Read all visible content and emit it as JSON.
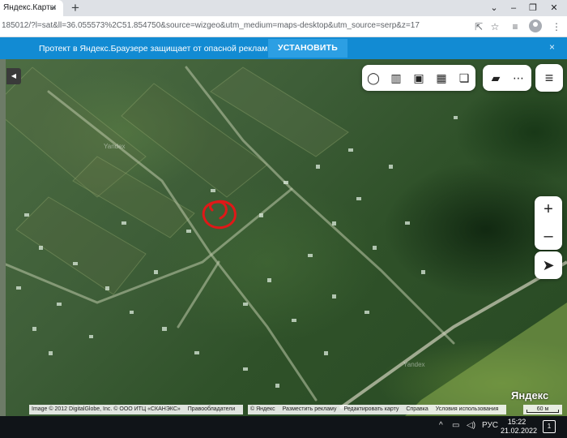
{
  "browser": {
    "tab_title": "Яндекс.Карты",
    "tab_close": "×",
    "new_tab": "+",
    "url": "185012/?l=sat&ll=36.055573%2C51.854750&source=wizgeo&utm_medium=maps-desktop&utm_source=serp&z=17",
    "window_buttons": [
      "⌄",
      "–",
      "❐",
      "✕"
    ]
  },
  "promo": {
    "text": "Протект в Яндекс.Браузере защищает от опасной рекламы",
    "button": "УСТАНОВИТЬ",
    "close": "×"
  },
  "map": {
    "watermarks": [
      "Yandex",
      "Yandex"
    ],
    "icons": [
      "layers-icon",
      "panorama-icon",
      "photo-icon",
      "transport-icon",
      "traffic-icon",
      "ruler-icon",
      "more-icon",
      "menu-icon"
    ],
    "zoom_in": "+",
    "zoom_out": "–"
  },
  "footer": {
    "left_items": [
      "Image © 2012 DigitalGlobe, Inc. © ООО ИТЦ «СКАНЭКС»",
      "Правообладатели"
    ],
    "right_items": [
      "© Яндекс",
      "Разместить рекламу",
      "Редактировать карту",
      "Справка",
      "Условия использования"
    ],
    "brand": "Яндекс",
    "scale": "60 м"
  },
  "taskbar": {
    "lang": "РУС",
    "time": "15:22",
    "date": "21.02.2022",
    "notifications": "1"
  }
}
